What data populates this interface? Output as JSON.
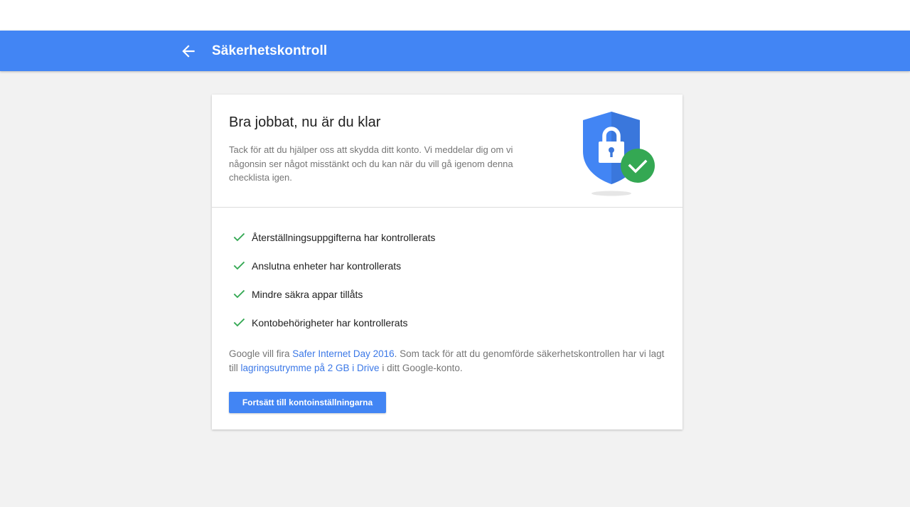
{
  "appbar": {
    "title": "Säkerhetskontroll",
    "back_icon": "arrow-back-icon",
    "color": "#4285f4"
  },
  "card": {
    "title": "Bra jobbat, nu är du klar",
    "description": "Tack för att du hjälper oss att skydda ditt konto. Vi meddelar dig om vi någonsin ser något misstänkt och du kan när du vill gå igenom denna checklista igen.",
    "illustration": "shield-lock-check-icon",
    "checklist": [
      {
        "label": "Återställningsuppgifterna har kontrollerats",
        "icon": "checkmark-icon"
      },
      {
        "label": "Anslutna enheter har kontrollerats",
        "icon": "checkmark-icon"
      },
      {
        "label": "Mindre säkra appar tillåts",
        "icon": "checkmark-icon"
      },
      {
        "label": "Kontobehörigheter har kontrollerats",
        "icon": "checkmark-icon"
      }
    ],
    "promo": {
      "text_1": "Google vill fira ",
      "link_1": "Safer Internet Day 2016",
      "text_2": ". Som tack för att du genomförde säkerhetskontrollen har vi lagt till ",
      "link_2": "lagringsutrymme på 2 GB i Drive",
      "text_3": " i ditt Google-konto."
    },
    "button_label": "Fortsätt till kontoinställningarna"
  },
  "colors": {
    "accent": "#4285f4",
    "check_green": "#34a853",
    "link": "#3b78e7"
  }
}
